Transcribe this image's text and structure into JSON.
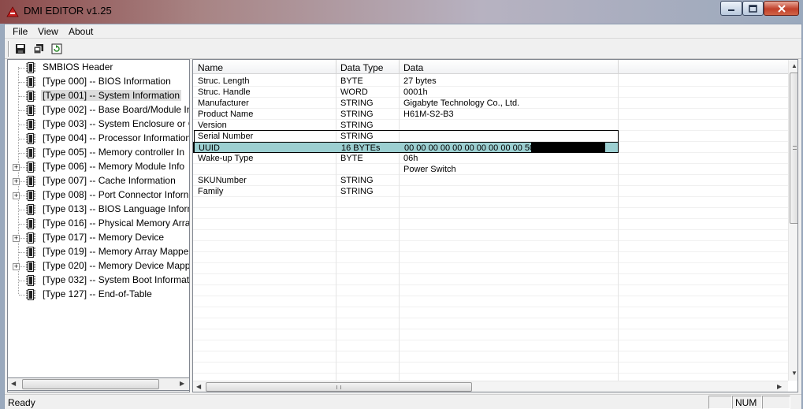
{
  "window": {
    "title": "DMI EDITOR v1.25"
  },
  "menu": [
    "File",
    "View",
    "About"
  ],
  "toolbar": {
    "buttons": [
      "save-icon",
      "copy-icon",
      "refresh-icon"
    ]
  },
  "tree": {
    "items": [
      {
        "label": "SMBIOS Header",
        "expandable": false
      },
      {
        "label": "[Type 000] -- BIOS Information",
        "expandable": false
      },
      {
        "label": "[Type 001] -- System Information",
        "expandable": false,
        "selected": true
      },
      {
        "label": "[Type 002] -- Base Board/Module In",
        "expandable": false
      },
      {
        "label": "[Type 003] -- System Enclosure or C",
        "expandable": false
      },
      {
        "label": "[Type 004] -- Processor Information",
        "expandable": false
      },
      {
        "label": "[Type 005] -- Memory controller In",
        "expandable": false
      },
      {
        "label": "[Type 006] -- Memory Module Info",
        "expandable": true
      },
      {
        "label": "[Type 007] -- Cache Information",
        "expandable": true
      },
      {
        "label": "[Type 008] -- Port Connector Inforn",
        "expandable": true
      },
      {
        "label": "[Type 013] -- BIOS Language Inform",
        "expandable": false
      },
      {
        "label": "[Type 016] -- Physical Memory Arra",
        "expandable": false
      },
      {
        "label": "[Type 017] -- Memory Device",
        "expandable": true
      },
      {
        "label": "[Type 019] -- Memory Array Mappe",
        "expandable": false
      },
      {
        "label": "[Type 020] -- Memory Device Mapp",
        "expandable": true
      },
      {
        "label": "[Type 032] -- System Boot Informat",
        "expandable": false
      },
      {
        "label": "[Type 127] -- End-of-Table",
        "expandable": false
      }
    ]
  },
  "grid": {
    "columns": [
      "Name",
      "Data Type",
      "Data"
    ],
    "rows": [
      {
        "name": "Struc. Length",
        "type": "BYTE",
        "data": "27 bytes"
      },
      {
        "name": "Struc. Handle",
        "type": "WORD",
        "data": "0001h"
      },
      {
        "name": "Manufacturer",
        "type": "STRING",
        "data": "Gigabyte Technology Co., Ltd."
      },
      {
        "name": "Product Name",
        "type": "STRING",
        "data": "H61M-S2-B3"
      },
      {
        "name": "Version",
        "type": "STRING",
        "data": ""
      },
      {
        "name": "Serial Number",
        "type": "STRING",
        "data": ""
      },
      {
        "name": "UUID",
        "type": "16 BYTEs",
        "data": "00 00 00 00 00 00 00 00 00 00 50",
        "selected": true,
        "redacted": true
      },
      {
        "name": "Wake-up Type",
        "type": "BYTE",
        "data": "06h"
      },
      {
        "name": "",
        "type": "",
        "data": "Power Switch"
      },
      {
        "name": "SKUNumber",
        "type": "STRING",
        "data": ""
      },
      {
        "name": "Family",
        "type": "STRING",
        "data": ""
      }
    ]
  },
  "status": {
    "text": "Ready",
    "num": "NUM"
  }
}
